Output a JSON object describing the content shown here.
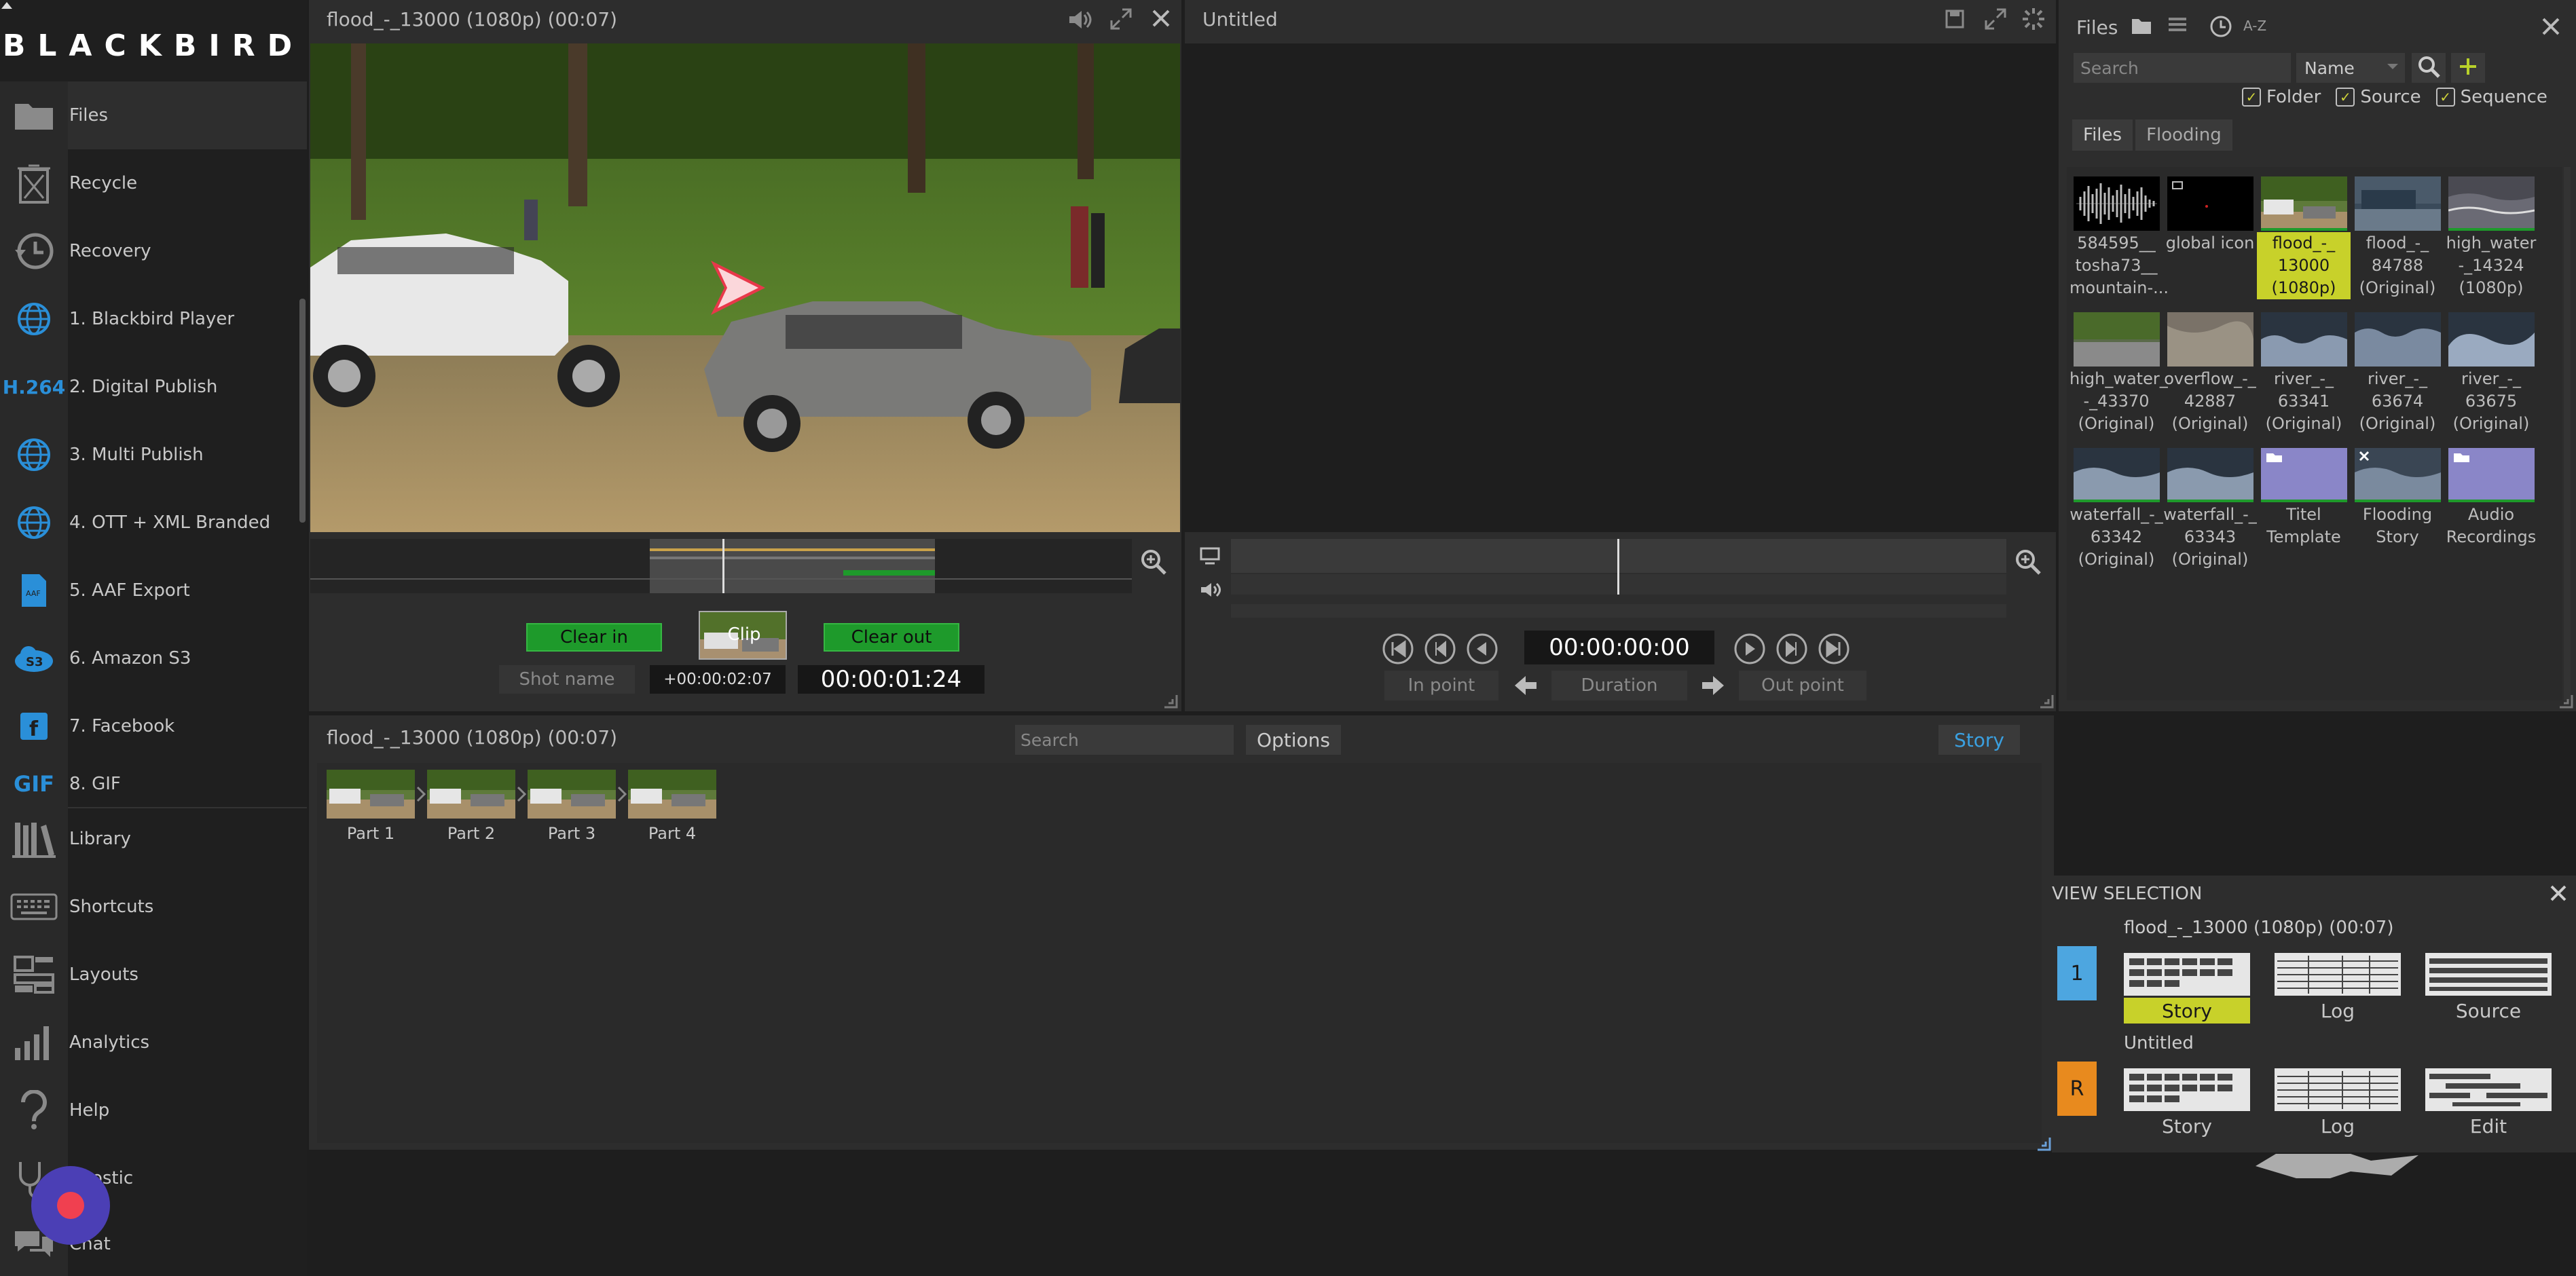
{
  "brand": {
    "logo_text": "BLACKBIRD"
  },
  "sidebar": {
    "items": [
      {
        "label": "Files",
        "icon": "folder-icon"
      },
      {
        "label": "Recycle",
        "icon": "recycle-bin-icon"
      },
      {
        "label": "Recovery",
        "icon": "history-icon"
      },
      {
        "label": "1. Blackbird Player",
        "icon": "globe-icon"
      },
      {
        "label": "2. Digital Publish",
        "icon": "h264-icon",
        "badge": "H.264"
      },
      {
        "label": "3. Multi Publish",
        "icon": "globe-icon"
      },
      {
        "label": "4. OTT + XML Branded",
        "icon": "globe-icon"
      },
      {
        "label": "5. AAF Export",
        "icon": "aaf-file-icon"
      },
      {
        "label": "6. Amazon S3",
        "icon": "s3-icon",
        "badge": "S3"
      },
      {
        "label": "7. Facebook",
        "icon": "facebook-icon"
      },
      {
        "label": "8. GIF",
        "icon": "gif-icon",
        "badge": "GIF"
      },
      {
        "label": "Library",
        "icon": "library-icon"
      },
      {
        "label": "Shortcuts",
        "icon": "keyboard-icon"
      },
      {
        "label": "Layouts",
        "icon": "layouts-icon"
      },
      {
        "label": "Analytics",
        "icon": "analytics-icon"
      },
      {
        "label": "Help",
        "icon": "help-icon"
      },
      {
        "label": "Diagnostic",
        "icon": "diagnostic-icon",
        "visible_label": "gnostic"
      },
      {
        "label": "Chat",
        "icon": "chat-icon"
      }
    ]
  },
  "source_viewer": {
    "title": "flood_-_13000 (1080p) (00:07)",
    "clear_in": "Clear in",
    "clip": "Clip",
    "clear_out": "Clear out",
    "shot_name": "Shot name",
    "offset": "+00:00:02:07",
    "duration_display": "00:00:01:24"
  },
  "sequence_viewer": {
    "title": "Untitled",
    "timecode": "00:00:00:00",
    "in_point": "In point",
    "duration": "Duration",
    "out_point": "Out point"
  },
  "files_panel": {
    "title": "Files",
    "sort_label": "A-Z",
    "search_placeholder": "Search",
    "sort_select": "Name",
    "filters": [
      "Folder",
      "Source",
      "Sequence"
    ],
    "breadcrumb": [
      "Files",
      "Flooding"
    ],
    "items": [
      {
        "name": "584595__tosha73__mountain-...",
        "lines": [
          "584595__",
          "tosha73__",
          "mountain-..."
        ]
      },
      {
        "name": "global icon",
        "lines": [
          "global icon"
        ]
      },
      {
        "name": "flood_-_13000 (1080p)",
        "lines": [
          "flood_-_",
          "13000",
          "(1080p)"
        ],
        "selected": true
      },
      {
        "name": "flood_-_84788 (Original)",
        "lines": [
          "flood_-_",
          "84788",
          "(Original)"
        ]
      },
      {
        "name": "high_water_-_14324 (1080p)",
        "lines": [
          "high_water",
          "-_14324",
          "(1080p)"
        ]
      },
      {
        "name": "high_water_-_43370 (Original)",
        "lines": [
          "high_water_",
          "-_43370",
          "(Original)"
        ]
      },
      {
        "name": "overflow_-_42887 (Original)",
        "lines": [
          "overflow_-_",
          "42887",
          "(Original)"
        ]
      },
      {
        "name": "river_-_63341 (Original)",
        "lines": [
          "river_-_",
          "63341",
          "(Original)"
        ]
      },
      {
        "name": "river_-_63674 (Original)",
        "lines": [
          "river_-_",
          "63674",
          "(Original)"
        ]
      },
      {
        "name": "river_-_63675 (Original)",
        "lines": [
          "river_-_",
          "63675",
          "(Original)"
        ]
      },
      {
        "name": "waterfall_-_63342 (Original)",
        "lines": [
          "waterfall_-_",
          "63342",
          "(Original)"
        ]
      },
      {
        "name": "waterfall_-_63343 (Original)",
        "lines": [
          "waterfall_-_",
          "63343",
          "(Original)"
        ]
      },
      {
        "name": "Titel Template",
        "lines": [
          "Titel",
          "Template"
        ]
      },
      {
        "name": "Flooding Story",
        "lines": [
          "Flooding",
          "Story"
        ]
      },
      {
        "name": "Audio Recordings",
        "lines": [
          "Audio",
          "Recordings"
        ]
      }
    ]
  },
  "story_panel": {
    "title": "flood_-_13000 (1080p) (00:07)",
    "search_placeholder": "Search",
    "options": "Options",
    "story_button": "Story",
    "parts": [
      "Part 1",
      "Part 2",
      "Part 3",
      "Part 4"
    ]
  },
  "view_selection": {
    "title": "VIEW SELECTION",
    "row1": {
      "badge": "1",
      "title": "flood_-_13000 (1080p) (00:07)",
      "options": [
        "Story",
        "Log",
        "Source"
      ],
      "selected": "Story"
    },
    "row2": {
      "badge": "R",
      "title": "Untitled",
      "options": [
        "Story",
        "Log",
        "Edit"
      ]
    }
  },
  "colors": {
    "accent_green": "#1e9a2b",
    "selected_yellow": "#c8d12a",
    "badge_blue": "#4da6e0",
    "badge_orange": "#e88a1e",
    "record_red": "#f04050"
  }
}
